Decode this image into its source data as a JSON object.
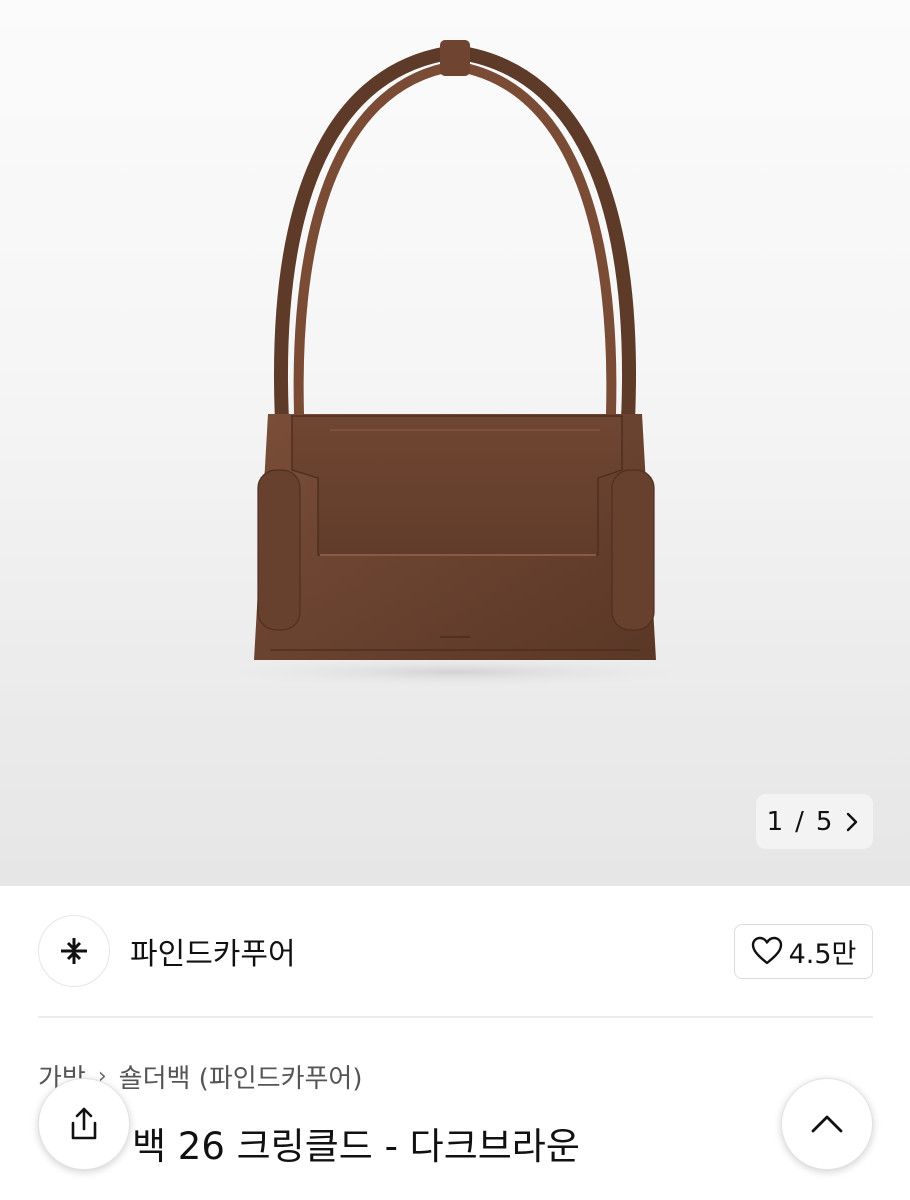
{
  "gallery": {
    "current": "1",
    "separator": "/",
    "total": "5"
  },
  "brand": {
    "name": "파인드카푸어",
    "likes": "4.5만"
  },
  "breadcrumb": {
    "category": "가방",
    "subcategory": "숄더백 (파인드카푸어)"
  },
  "product": {
    "title_visible": "백 26 크링클드 - 다크브라운"
  },
  "colors": {
    "bag": "#6b4330",
    "background": "#f4f4f4"
  },
  "icons": {
    "like": "heart-icon",
    "next": "chevron-right-icon",
    "share": "share-icon",
    "scroll_top": "chevron-up-icon",
    "brand": "brand-logo-icon"
  }
}
